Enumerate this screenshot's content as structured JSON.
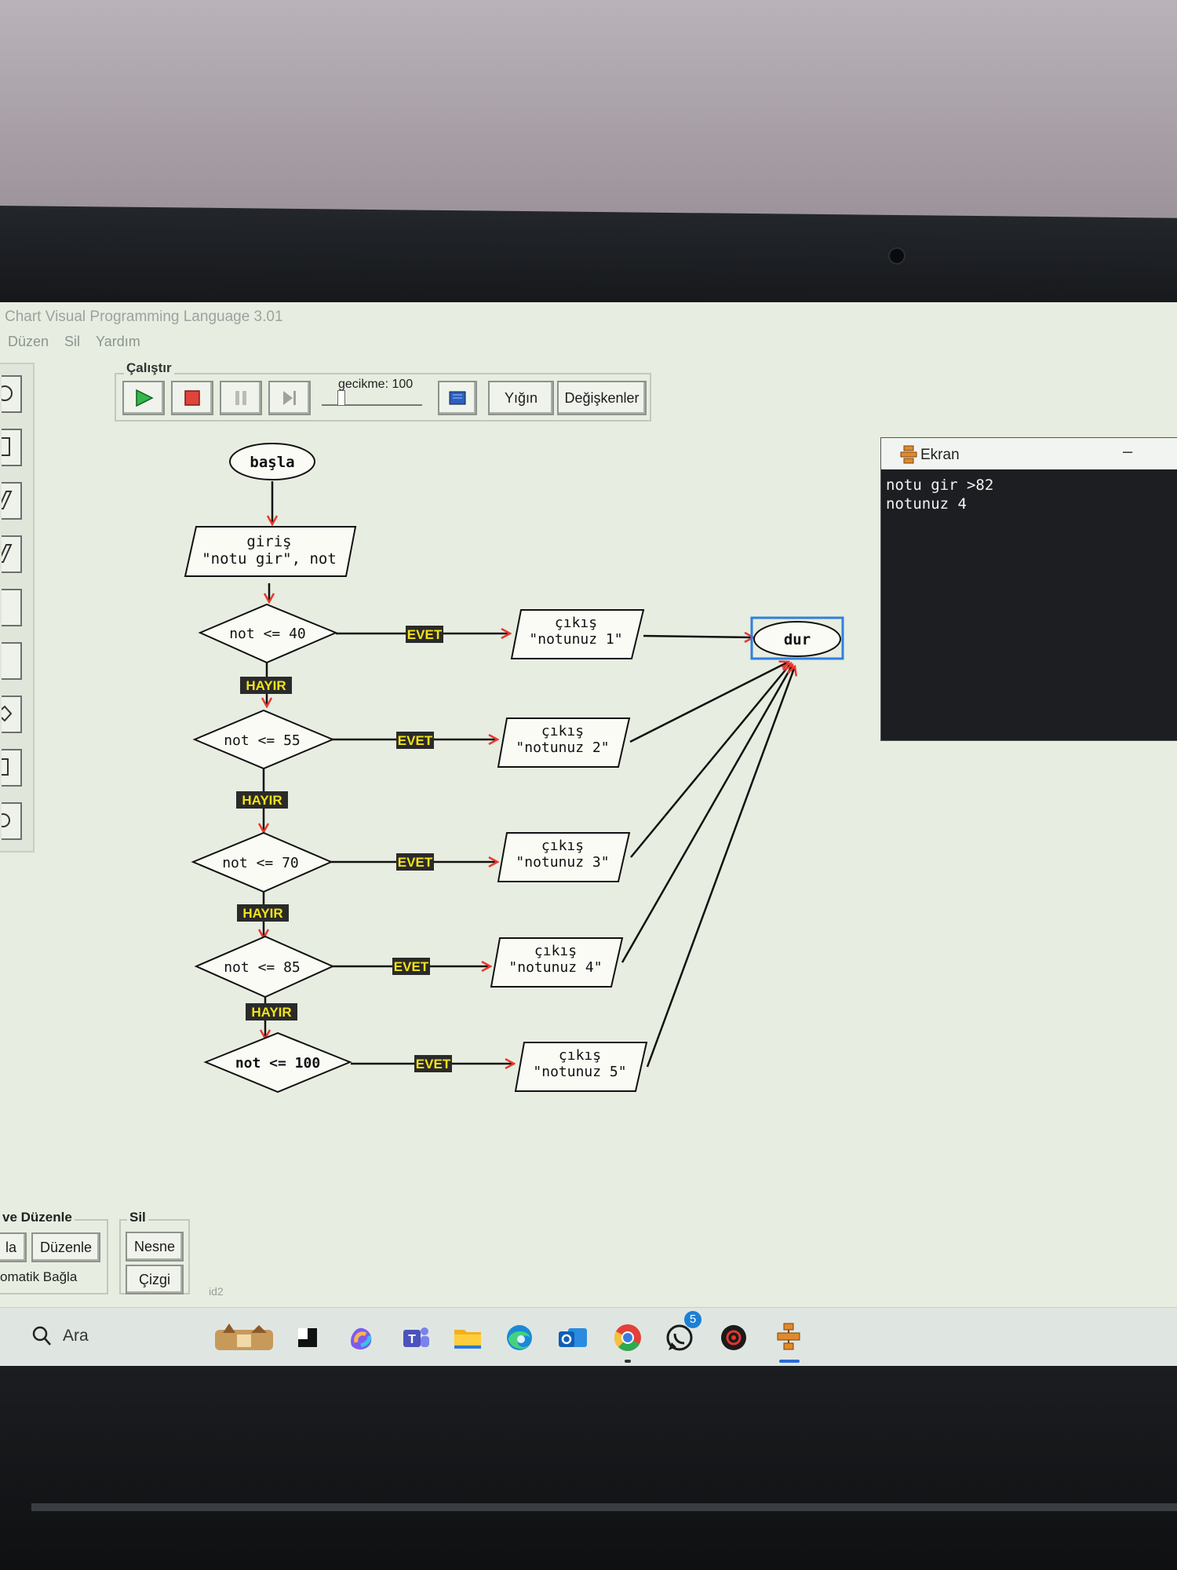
{
  "app": {
    "title": "Chart Visual Programming Language 3.01",
    "menu": [
      "Düzen",
      "Sil",
      "Yardım"
    ]
  },
  "run_toolbar": {
    "group_label": "Çalıştır",
    "delay_label": "gecikme: 100",
    "stack_button": "Yığın",
    "variables_button": "Değişkenler"
  },
  "flowchart": {
    "start": "başla",
    "input_line1": "giriş",
    "input_line2": "\"notu gir\", not",
    "conditions": [
      "not <= 40",
      "not <= 55",
      "not <= 70",
      "not <= 85",
      "not <= 100"
    ],
    "yes_label": "EVET",
    "no_label": "HAYIR",
    "output_keyword": "çıkış",
    "outputs": [
      "\"notunuz 1\"",
      "\"notunuz 2\"",
      "\"notunuz 3\"",
      "\"notunuz 4\"",
      "\"notunuz 5\""
    ],
    "end": "dur"
  },
  "screen_window": {
    "title": "Ekran",
    "minimize": "–",
    "output_lines": [
      "notu gir >82",
      "notunuz 4"
    ]
  },
  "bottom_panel": {
    "arrange_group_label": "ve Düzenle",
    "arrange_left_partial": "la",
    "arrange_button": "Düzenle",
    "auto_connect_partial": "omatik Bağla",
    "delete_group_label": "Sil",
    "delete_object_button": "Nesne",
    "delete_line_button": "Çizgi",
    "status_id": "id2"
  },
  "taskbar": {
    "search_label": "Ara",
    "whatsapp_badge": "5"
  },
  "colors": {
    "label_bg": "#2a2a2a",
    "label_text": "#f2e21a",
    "arrow_head": "#e8382c",
    "selection": "#2f7fe0",
    "screen_bg": "#e7ede0"
  }
}
